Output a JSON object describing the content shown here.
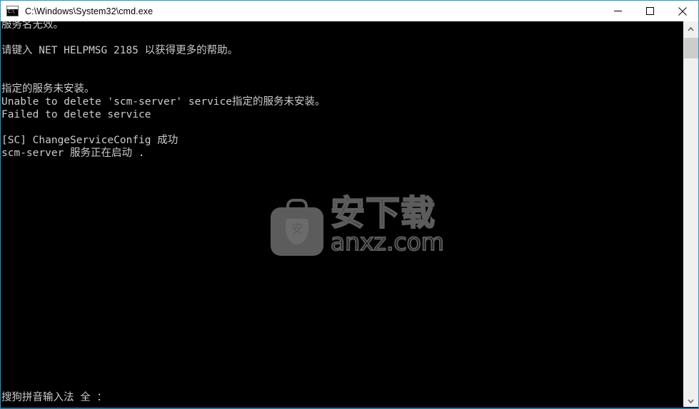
{
  "window": {
    "title": "C:\\Windows\\System32\\cmd.exe",
    "icon": "cmd-icon",
    "icon_text": "C:\\",
    "border_color": "#3f8fb0",
    "titlebar_bg": "#ffffff",
    "console_bg": "#000000",
    "console_fg": "#cccccc"
  },
  "controls": {
    "minimize": "minimize-icon",
    "maximize": "maximize-icon",
    "close": "close-icon"
  },
  "console": {
    "lines": [
      "服务名无效。",
      "",
      "请键入 NET HELPMSG 2185 以获得更多的帮助。",
      "",
      "",
      "指定的服务未安装。",
      "Unable to delete 'scm-server' service指定的服务未安装。",
      "Failed to delete service",
      "",
      "[SC] ChangeServiceConfig 成功",
      "scm-server 服务正在启动 ."
    ],
    "ime_status": "搜狗拼音输入法 全 ："
  },
  "watermark": {
    "logo_glyph": "安",
    "chinese": "安下载",
    "domain": "anxz.com",
    "color": "#5c5c5c"
  },
  "scrollbar": {
    "up_arrow": "chevron-up-icon",
    "down_arrow": "chevron-down-icon",
    "thumb": "scrollbar-thumb"
  }
}
